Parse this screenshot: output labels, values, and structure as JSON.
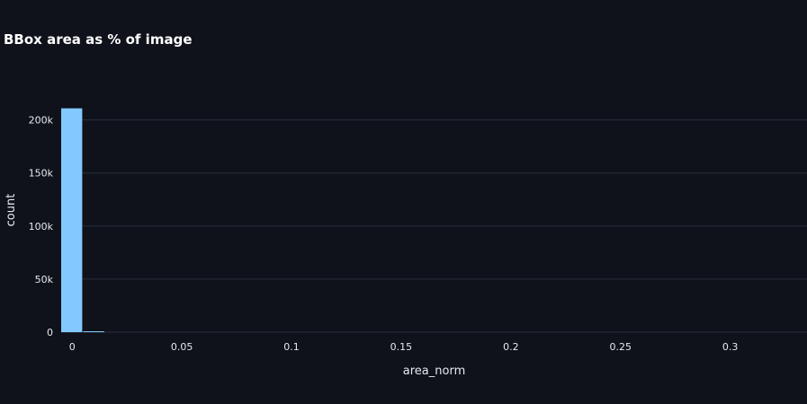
{
  "chart_data": {
    "type": "bar",
    "title": "BBox area as % of image",
    "xlabel": "area_norm",
    "ylabel": "count",
    "xlim": [
      -0.005,
      0.335
    ],
    "ylim": [
      0,
      220000
    ],
    "x_ticks": [
      {
        "value": 0,
        "label": "0"
      },
      {
        "value": 0.05,
        "label": "0.05"
      },
      {
        "value": 0.1,
        "label": "0.1"
      },
      {
        "value": 0.15,
        "label": "0.15"
      },
      {
        "value": 0.2,
        "label": "0.2"
      },
      {
        "value": 0.25,
        "label": "0.25"
      },
      {
        "value": 0.3,
        "label": "0.3"
      }
    ],
    "y_ticks": [
      {
        "value": 0,
        "label": "0"
      },
      {
        "value": 50000,
        "label": "50k"
      },
      {
        "value": 100000,
        "label": "100k"
      },
      {
        "value": 150000,
        "label": "150k"
      },
      {
        "value": 200000,
        "label": "200k"
      }
    ],
    "grid": true,
    "bar_color": "#83c9ff",
    "bins": [
      {
        "x0": -0.005,
        "x1": 0.005,
        "count": 211000
      },
      {
        "x0": 0.005,
        "x1": 0.015,
        "count": 700
      }
    ]
  },
  "colors": {
    "background": "#0f121a",
    "grid": "#2b2f3a",
    "text": "#e6e9ef",
    "title": "#ffffff"
  }
}
